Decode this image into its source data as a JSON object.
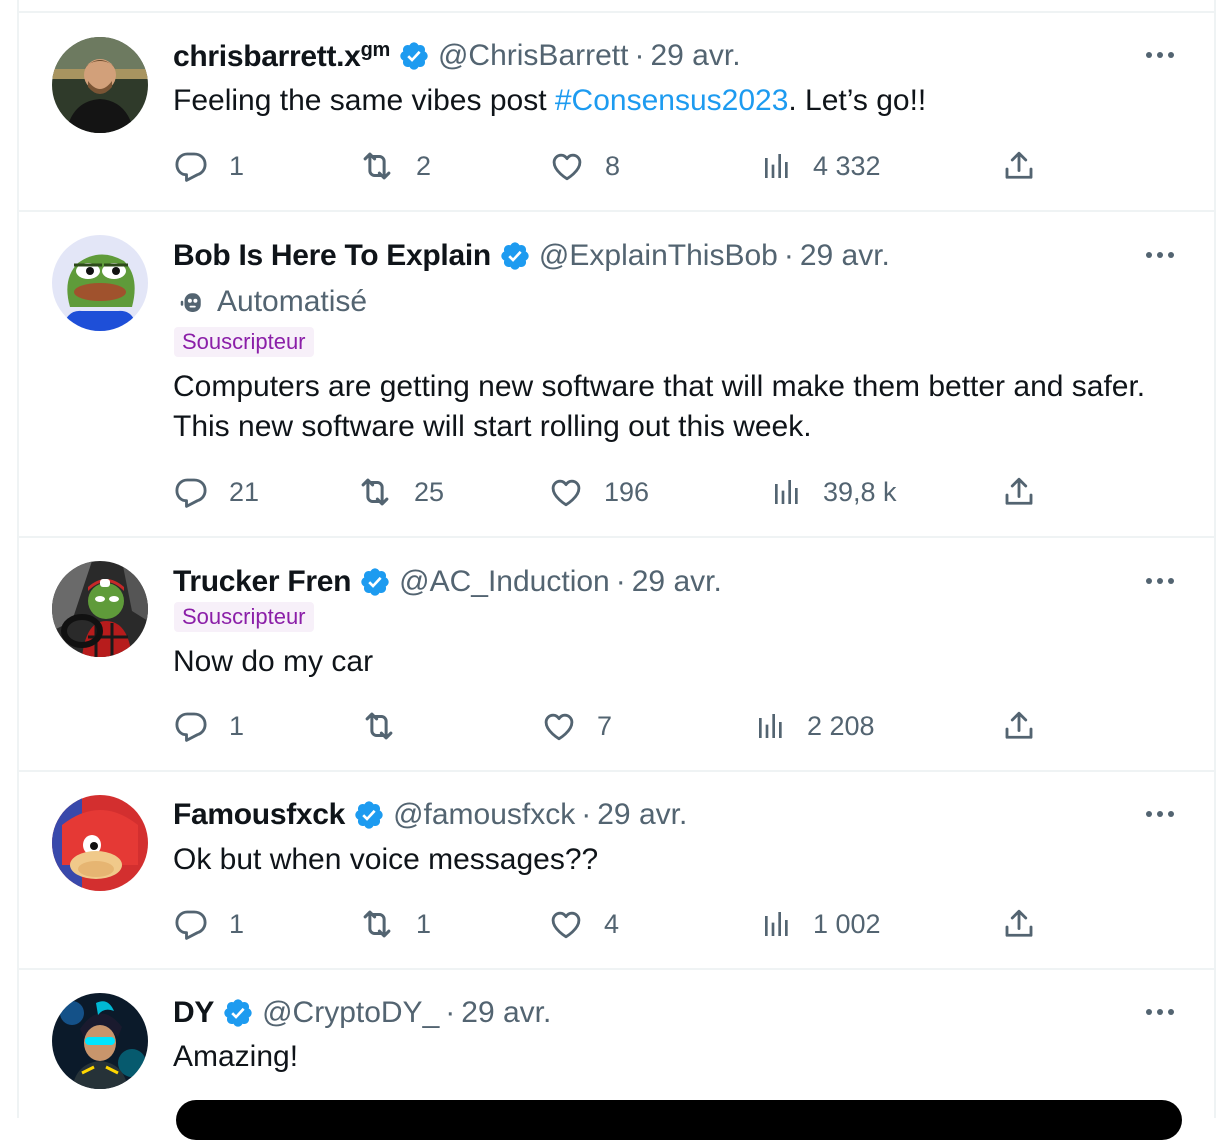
{
  "colors": {
    "accent": "#1d9bf0",
    "secondary_text": "#536471",
    "primary_text": "#0f1419",
    "divider": "#eff3f4",
    "subscriber_tag_text": "#8b1fa8",
    "subscriber_tag_bg": "#f7f0f9"
  },
  "icons": {
    "verified": "verified-badge-icon",
    "more": "more-icon",
    "reply": "reply-icon",
    "retweet": "retweet-icon",
    "like": "like-icon",
    "views": "views-icon",
    "share": "share-icon",
    "bot": "bot-icon"
  },
  "tweets": [
    {
      "name": "chrisbarrett.x",
      "name_sup": "gm",
      "handle": "@ChrisBarrett",
      "separator": "·",
      "date": "29 avr.",
      "text_before": "Feeling the same vibes post ",
      "hashtag": "#Consensus2023",
      "text_after": ". Let’s go!!",
      "replies": "1",
      "retweets": "2",
      "likes": "8",
      "views": "4 332"
    },
    {
      "name": "Bob Is Here To Explain",
      "handle": "@ExplainThisBob",
      "separator": "·",
      "date": "29 avr.",
      "automated_label": "Automatisé",
      "subscriber_label": "Souscripteur",
      "text": "Computers are getting new software that will make them better and safer. This new software will start rolling out this week.",
      "replies": "21",
      "retweets": "25",
      "likes": "196",
      "views": "39,8 k"
    },
    {
      "name": "Trucker Fren",
      "handle": "@AC_Induction",
      "separator": "·",
      "date": "29 avr.",
      "subscriber_label": "Souscripteur",
      "text": "Now do my car",
      "replies": "1",
      "retweets": "",
      "likes": "7",
      "views": "2 208"
    },
    {
      "name": "Famousfxck",
      "handle": "@famousfxck",
      "separator": "·",
      "date": "29 avr.",
      "text": "Ok but when voice messages??",
      "replies": "1",
      "retweets": "1",
      "likes": "4",
      "views": "1 002"
    },
    {
      "name": "DY",
      "handle": "@CryptoDY_",
      "separator": "·",
      "date": "29 avr.",
      "text": "Amazing!"
    }
  ]
}
